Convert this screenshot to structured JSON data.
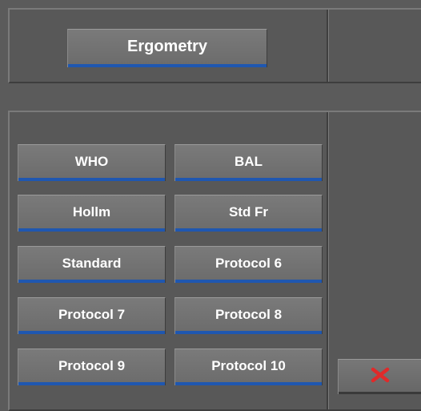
{
  "top_panel": {
    "title_button": "Ergometry"
  },
  "protocol_buttons": [
    {
      "label": "WHO"
    },
    {
      "label": "BAL"
    },
    {
      "label": "Hollm"
    },
    {
      "label": "Std Fr"
    },
    {
      "label": "Standard"
    },
    {
      "label": "Protocol 6"
    },
    {
      "label": "Protocol 7"
    },
    {
      "label": "Protocol 8"
    },
    {
      "label": "Protocol 9"
    },
    {
      "label": "Protocol 10"
    }
  ],
  "close_button": {
    "icon": "close-icon",
    "color": "#e02a2a"
  },
  "colors": {
    "accent": "#1f57b0",
    "panel": "#585858"
  }
}
